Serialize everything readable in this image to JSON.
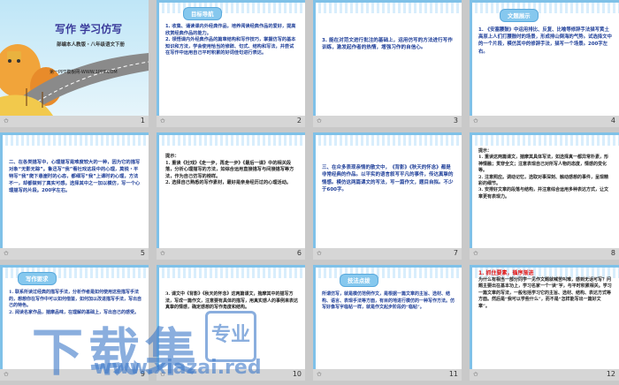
{
  "slides": [
    {
      "n": "1",
      "title": "写作  学习仿写",
      "sub": "部编本人教版・八年级语文下册",
      "brand": "第一PPT模板网-WWW.1PPT.COM"
    },
    {
      "n": "2",
      "tag": "目标导航",
      "lines": [
        "1. 收集、诵读课内外经典作品，培养阅读经典作品的爱好，提高欣赏经典作品的能力。",
        "2. 领悟课内外经典作品的篇章结构和写作技巧，掌握仿写的基本知识和方法，学会使用恰当的修辞、句式、结构和写法，并尝试在写作中运用自己平时积累的好词佳句进行表达。"
      ]
    },
    {
      "n": "3",
      "lines": [
        "3. 能在对范文进行批注的基础上，运用仿写的方法进行写作训练，激发起作者的热情，增强习作的自信心。"
      ]
    },
    {
      "n": "4",
      "tag": "文题展示",
      "lines": [
        "1. 《安塞腰鼓》中运用排比、反复、比喻等修辞手法描写黄土高原上人们打腰鼓时的场景，形成排山倒海的气势。试选择文中的一个片段，模仿其中的修辞手法，描写一个场景。200字左右。"
      ]
    },
    {
      "n": "5",
      "lines": [
        "二、在各类描写中，心理描写是难度较大的一种，因为它的描写对象“无影无踪”。鲁迅写“我”看社戏这段中的心理，莫锐・平特写“我”爬下悬崖时的心态，都细写“我”上课时的心理，方法不一，却都做到了真实可感。选择其中之一加以模仿，写一个心理描写的片段。200字左右。"
      ]
    },
    {
      "n": "6",
      "lines": [
        "提示：",
        "1. 重读《社戏》《走一步，再走一步》《最后一课》中的相关段落，分析心理描写的方法，如综合运用直接描写与间接描写等方法，作为自己仿写的榜样。",
        "2. 选择自己熟悉的写作素材，最好是亲身经历过的心理活动。"
      ]
    },
    {
      "n": "7",
      "lines": [
        "三、在众多表现亲情的散文中，《背影》《秋天的怀念》都是非常经典的作品。以平实的语言叙写平凡的事件，传达真挚的情感。模仿这两篇课文的写法，写一篇作文，题目自拟。不少于600字。"
      ]
    },
    {
      "n": "8",
      "lines": [
        "提示：",
        "1. 重读这两篇课文，揣摩其具体写法，如选择真一都异常朴素，形神情融；贯穿全文；注意表现自己对所写人物的态度，情感的变化等。",
        "2. 注意照应。调动记忆，选取对事深刻、触动感想的事件，呈现精彩的细节。",
        "3. 安排好文章的段落与结构，并注意综合运用多种表达方式，让文章更有表现力。"
      ]
    },
    {
      "n": "9",
      "tag": "写作要求",
      "lines": [
        "1. 联系所读过经典的描写手法，分析作者是如何使用这些描写手法的，想想你在写作中可以如何借鉴，如何加以改进描写手法，写出自己的特色。",
        "2. 阅读名家作品，揣摩品味，在理解的基础上，写出自己的感受。"
      ]
    },
    {
      "n": "10",
      "lines": [
        "3. 课文中《背影》《秋天的怀念》这两篇课文，揣摩其中的描写方法，写成一篇作文，注意要有具体的描写，用真实感人的事例来表达真挚的情感，确定感想的写作角度和结构。"
      ]
    },
    {
      "n": "11",
      "tag": "技法点拨",
      "lines": [
        "所谓仿写，就是模仿范例作文，是根据一篇文章的主旨、选材、结构、语言、表现手法等方面，有目的地进行模仿的一种写作方法。仿写好像写字临帖一样，就是作文起步阶段的“临帖”。"
      ]
    },
    {
      "n": "12",
      "head": "1. 抓住要素，循序渐进",
      "lines": [
        "为什么有相当一部分同学一见作文题就喊苦叫难，感到无话可写？问题主要出在基本功上，学习名家一个“读”字，与平时积累相关。学习一篇文章的写法，一般包括学习它的主旨、选材、结构、表达方式等方面。然后是“我可以学些什么”，而不是“怎样能写出一篇好文章”。"
      ]
    }
  ],
  "watermark": {
    "big": "下载集",
    "box": "专业",
    "url": "www.xiazai.red"
  }
}
